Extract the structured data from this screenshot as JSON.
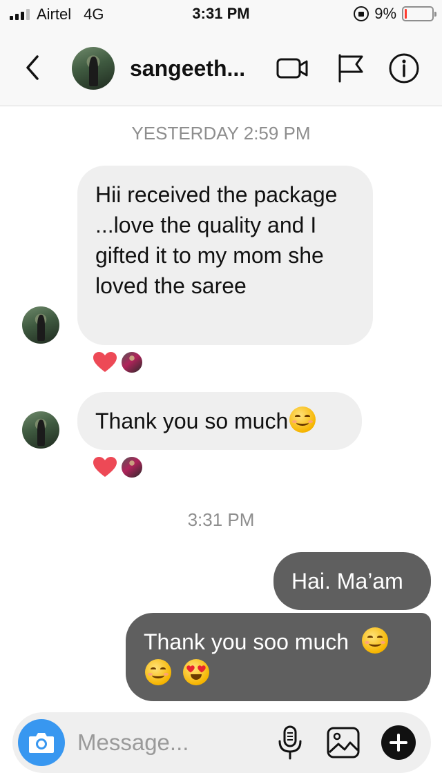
{
  "status_bar": {
    "carrier": "Airtel",
    "network": "4G",
    "time": "3:31 PM",
    "battery_percent": "9%",
    "battery_level": 0.09
  },
  "header": {
    "back_icon": "chevron-left-icon",
    "username": "sangeeth...",
    "video_icon": "video-call-icon",
    "flag_icon": "flag-icon",
    "info_icon": "info-icon"
  },
  "thread": {
    "timestamp_1": "YESTERDAY 2:59 PM",
    "timestamp_2": "3:31 PM",
    "messages": [
      {
        "direction": "incoming",
        "text": "Hii received the package ...love the quality and I gifted it to my mom she loved the saree",
        "reaction": "heart"
      },
      {
        "direction": "incoming",
        "text": "Thank you so much",
        "trailing_emoji": "smiling-face-icon",
        "reaction": "heart"
      },
      {
        "direction": "outgoing",
        "text": "Hai. Ma’am"
      },
      {
        "direction": "outgoing",
        "text": "Thank you soo much",
        "emojis": [
          "smiling-face-icon",
          "smiling-face-icon",
          "heart-eyes-face-icon"
        ]
      }
    ]
  },
  "composer": {
    "placeholder": "Message...",
    "camera_icon": "camera-icon",
    "mic_icon": "microphone-icon",
    "gallery_icon": "image-gallery-icon",
    "plus_icon": "plus-icon",
    "accent_color": "#3897f0"
  },
  "colors": {
    "incoming_bubble": "#efefef",
    "outgoing_bubble": "#5f5f5f",
    "reaction_heart": "#ed4956",
    "timestamp_text": "#8e8e8e"
  }
}
